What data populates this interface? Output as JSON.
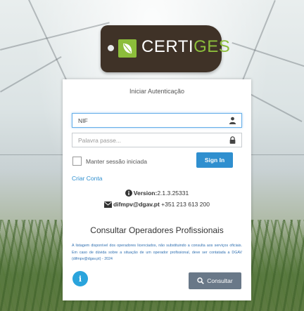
{
  "logo": {
    "text_main": "CERTI",
    "text_accent": "GES",
    "accent_color": "#8cbd3b"
  },
  "login": {
    "title": "Iniciar Autenticação",
    "nif": {
      "value": "NIF",
      "icon": "user-icon"
    },
    "password": {
      "placeholder": "Palavra passe...",
      "icon": "lock-icon"
    },
    "remember_label": "Manter sessão iniciada",
    "signin_label": "Sign In",
    "create_account": "Criar Conta"
  },
  "info": {
    "version_label": "Version:",
    "version_value": "2.1.3.25331",
    "email": "difmpv@dgav.pt",
    "phone": "+351 213 613 200"
  },
  "consult": {
    "title": "Consultar Operadores Profissionais",
    "description": "A listagem disponível dos operadores licenciados, não substituindo a consulta aos serviços oficiais. Em caso de dúvida sobre a situação de um operador profissional, deve ser contatada a DGAV (difmpv@dgav.pt) - 2024",
    "info_button": "i",
    "button_label": "Consultar"
  },
  "colors": {
    "primary": "#2f8fcf",
    "secondary": "#697888",
    "logo_bg": "#3f3227"
  }
}
